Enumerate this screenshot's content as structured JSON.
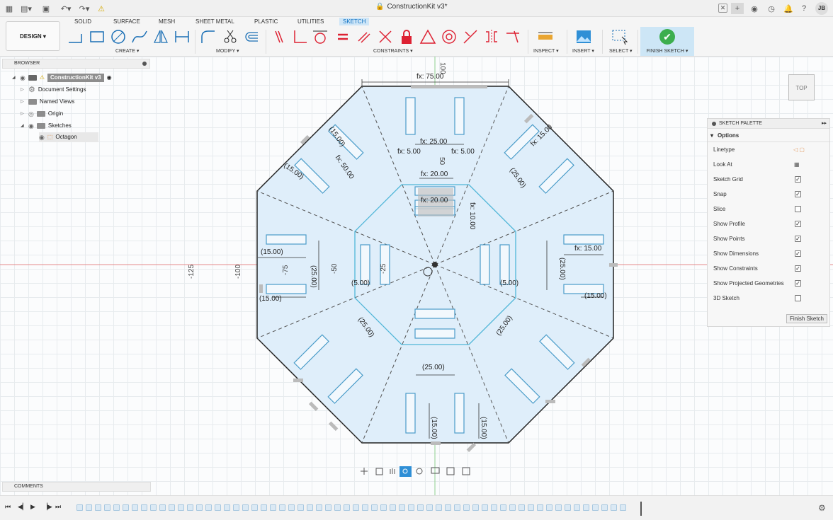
{
  "titlebar": {
    "doc_title": "ConstructionKit v3*",
    "user_initials": "JB"
  },
  "ribbon": {
    "workspace": "DESIGN ▾",
    "tabs": [
      "SOLID",
      "SURFACE",
      "MESH",
      "SHEET METAL",
      "PLASTIC",
      "UTILITIES",
      "SKETCH"
    ],
    "groups": {
      "create": "CREATE ▾",
      "modify": "MODIFY ▾",
      "constraints": "CONSTRAINTS ▾",
      "inspect": "INSPECT ▾",
      "insert": "INSERT ▾",
      "select": "SELECT ▾"
    },
    "finish": "FINISH SKETCH ▾"
  },
  "browser": {
    "title": "BROWSER",
    "root": "ConstructionKit v3",
    "items": [
      "Document Settings",
      "Named Views",
      "Origin",
      "Sketches"
    ],
    "sketch": "Octagon"
  },
  "comments": {
    "title": "COMMENTS"
  },
  "palette": {
    "title": "SKETCH PALETTE",
    "options_label": "Options",
    "rows": [
      {
        "label": "Linetype",
        "kind": "icon"
      },
      {
        "label": "Look At",
        "kind": "icon"
      },
      {
        "label": "Sketch Grid",
        "checked": true
      },
      {
        "label": "Snap",
        "checked": true
      },
      {
        "label": "Slice",
        "checked": false
      },
      {
        "label": "Show Profile",
        "checked": true
      },
      {
        "label": "Show Points",
        "checked": true
      },
      {
        "label": "Show Dimensions",
        "checked": true
      },
      {
        "label": "Show Constraints",
        "checked": true
      },
      {
        "label": "Show Projected Geometries",
        "checked": true
      },
      {
        "label": "3D Sketch",
        "checked": false
      }
    ],
    "finish_button": "Finish Sketch"
  },
  "viewcube": {
    "face": "TOP"
  },
  "axis_labels": {
    "x": [
      "-125",
      "-100",
      "-75",
      "-50",
      "-25"
    ],
    "y": [
      "100",
      "50"
    ]
  },
  "dimensions": {
    "top_width": "fx: 75.00",
    "inner_width": "fx: 20.00",
    "mid_width": "fx: 25.00",
    "r15": "(15.00)",
    "r25": "(25.00)",
    "r5": "(5.00)",
    "fx15": "fx: 15.00",
    "fx5": "fx: 5.00",
    "fx50": "fx: 50.00",
    "fx10": "fx: 10.00",
    "fx20": "fx: 20.00",
    "fx5b": "fx: 5.00"
  },
  "colors": {
    "accent": "#0a6fc2",
    "sketch_fill": "#dfeefa",
    "sketch_line": "#222222",
    "construction": "#4fb6d8",
    "finish_green": "#3cae4e"
  }
}
